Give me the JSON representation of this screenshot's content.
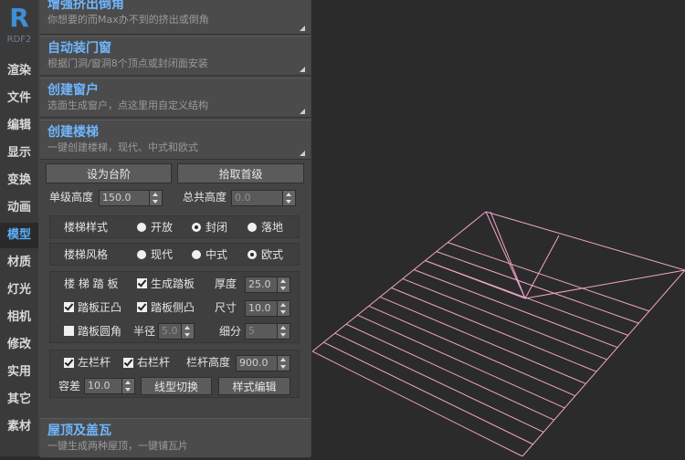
{
  "app": {
    "logo": "R",
    "version": "RDF2"
  },
  "sidebar": {
    "items": [
      {
        "label": "渲染"
      },
      {
        "label": "文件"
      },
      {
        "label": "编辑"
      },
      {
        "label": "显示"
      },
      {
        "label": "变换"
      },
      {
        "label": "动画"
      },
      {
        "label": "模型"
      },
      {
        "label": "材质"
      },
      {
        "label": "灯光"
      },
      {
        "label": "相机"
      },
      {
        "label": "修改"
      },
      {
        "label": "实用"
      },
      {
        "label": "其它"
      },
      {
        "label": "素材"
      }
    ],
    "active": "模型"
  },
  "rollouts": [
    {
      "title": "增强挤出倒角",
      "subtitle": "你想要的而Max办不到的挤出或倒角"
    },
    {
      "title": "自动装门窗",
      "subtitle": "根据门洞/窗洞8个顶点或封闭面安装"
    },
    {
      "title": "创建窗户",
      "subtitle": "选面生成窗户，点这里用自定义结构"
    },
    {
      "title": "创建楼梯",
      "subtitle": "一键创建楼梯，现代、中式和欧式"
    },
    {
      "title": "屋顶及盖瓦",
      "subtitle": "一键生成两种屋顶，一键铺瓦片"
    }
  ],
  "stairs": {
    "set_step": "设为台阶",
    "pick_first": "拾取首级",
    "step_height_label": "单级高度",
    "step_height": "150.0",
    "total_height_label": "总共高度",
    "total_height": "0.0",
    "style_label": "楼梯样式",
    "style_options": [
      "开放",
      "封闭",
      "落地"
    ],
    "style_selected": "封闭",
    "flavor_label": "楼梯风格",
    "flavor_options": [
      "现代",
      "中式",
      "欧式"
    ],
    "flavor_selected": "欧式",
    "tread_label": "楼 梯 踏 板",
    "gen_tread": "生成踏板",
    "thickness_label": "厚度",
    "thickness": "25.0",
    "tread_front": "踏板正凸",
    "tread_side": "踏板侧凸",
    "size_label": "尺寸",
    "size": "10.0",
    "tread_round": "踏板圆角",
    "radius_label": "半径",
    "radius": "5.0",
    "subdiv_label": "细分",
    "subdiv": "5",
    "left_rail": "左栏杆",
    "right_rail": "右栏杆",
    "rail_height_label": "栏杆高度",
    "rail_height": "900.0",
    "tolerance_label": "容差",
    "tolerance": "10.0",
    "line_switch": "线型切换",
    "style_edit": "样式编辑"
  },
  "colors": {
    "accent": "#6fb6ff",
    "wire": "#f0a6c8"
  }
}
